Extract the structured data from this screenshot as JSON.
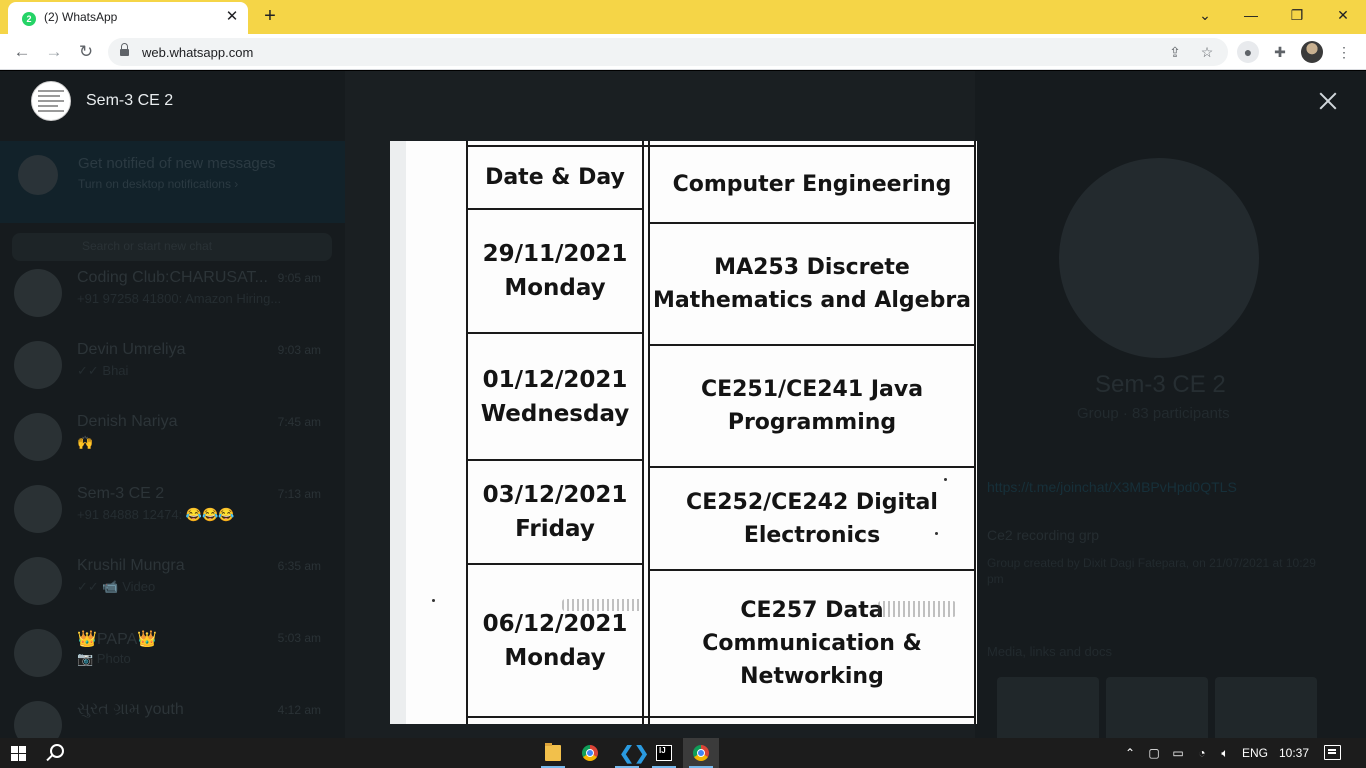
{
  "browser": {
    "tab_title": "(2) WhatsApp",
    "tab_badge": "2",
    "url": "web.whatsapp.com"
  },
  "whatsapp_background": {
    "notification_title": "Get notified of new messages",
    "notification_sub": "Turn on desktop notifications ›",
    "search_placeholder": "Search or start new chat",
    "chats": [
      {
        "name": "Coding Club:CHARUSAT...",
        "time": "9:05 am",
        "message": "+91 97258 41800: Amazon Hiring..."
      },
      {
        "name": "Devin Umreliya",
        "time": "9:03 am",
        "message": "✓✓ Bhai"
      },
      {
        "name": "Denish Nariya",
        "time": "7:45 am",
        "message": "🙌"
      },
      {
        "name": "Sem-3 CE 2",
        "time": "7:13 am",
        "message": "+91 84888 12474: 😂😂😂"
      },
      {
        "name": "Krushil Mungra",
        "time": "6:35 am",
        "message": "✓✓ 📹 Video"
      },
      {
        "name": "👑PAPA👑",
        "time": "5:03 am",
        "message": "📷 Photo"
      },
      {
        "name": "સુરત ગ્રામ youth",
        "time": "4:12 am",
        "message": ""
      }
    ],
    "group_info": {
      "name": "Sem-3 CE 2",
      "subtitle": "Group · 83 participants",
      "link": "https://t.me/joinchat/X3MBPvHpd0QTLS",
      "description": "Ce2 recording grp",
      "created": "Group created by Dixit Dagi Fatepara, on 21/07/2021 at 10:29 pm",
      "media_label": "Media, links and docs"
    }
  },
  "media_viewer": {
    "chat_name": "Sem-3 CE 2",
    "image": {
      "header_date": "Date & Day",
      "header_branch": "Computer Engineering",
      "rows": [
        {
          "date": "29/11/2021",
          "day": "Monday",
          "subject_line1": "MA253 Discrete",
          "subject_line2": "Mathematics and Algebra",
          "subject_line3": ""
        },
        {
          "date": "01/12/2021",
          "day": "Wednesday",
          "subject_line1": "CE251/CE241 Java",
          "subject_line2": "Programming",
          "subject_line3": ""
        },
        {
          "date": "03/12/2021",
          "day": "Friday",
          "subject_line1": "CE252/CE242 Digital",
          "subject_line2": "Electronics",
          "subject_line3": ""
        },
        {
          "date": "06/12/2021",
          "day": "Monday",
          "subject_line1": "CE257 Data",
          "subject_line2": "Communication &",
          "subject_line3": "Networking"
        }
      ]
    }
  },
  "taskbar": {
    "language": "ENG",
    "time": "10:37"
  },
  "colors": {
    "tab_strip": "#f5d547",
    "overlay": "#1a1f22",
    "whatsapp_green": "#25d366"
  }
}
